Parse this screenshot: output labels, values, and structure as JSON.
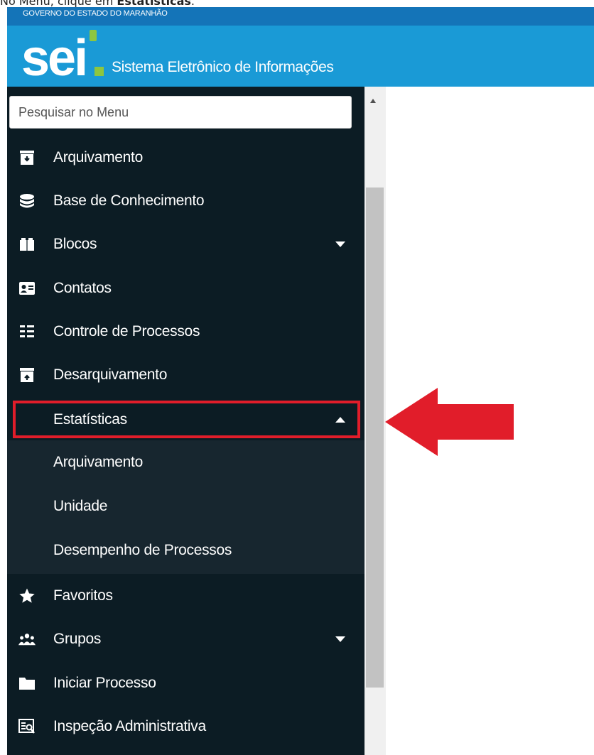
{
  "instruction": {
    "prefix": "No Menu, clique em",
    "emphasis": "Estatísticas",
    "suffix": "."
  },
  "gov_bar": {
    "text": "GOVERNO DO ESTADO DO MARANHÃO"
  },
  "header": {
    "logo_text": "sei",
    "title": "Sistema Eletrônico de Informações"
  },
  "search": {
    "placeholder": "Pesquisar no Menu"
  },
  "menu": {
    "arquivamento": "Arquivamento",
    "base_conhecimento": "Base de Conhecimento",
    "blocos": "Blocos",
    "contatos": "Contatos",
    "controle_processos": "Controle de Processos",
    "desarquivamento": "Desarquivamento",
    "estatisticas": "Estatísticas",
    "sub_arquivamento": "Arquivamento",
    "sub_unidade": "Unidade",
    "sub_desempenho": "Desempenho de Processos",
    "favoritos": "Favoritos",
    "grupos": "Grupos",
    "iniciar_processo": "Iniciar Processo",
    "inspecao": "Inspeção Administrativa"
  },
  "colors": {
    "gov_bar": "#1474b8",
    "header": "#1a9ad6",
    "sidebar": "#0c1c24",
    "submenu": "#17262f",
    "highlight": "#e11d2a",
    "logo_green": "#8dc63f"
  },
  "icons": {
    "arquivamento": "archive-down-icon",
    "base_conhecimento": "database-icon",
    "blocos": "blocks-icon",
    "contatos": "contact-card-icon",
    "controle_processos": "list-icon",
    "desarquivamento": "archive-up-icon",
    "favoritos": "star-icon",
    "grupos": "users-group-icon",
    "iniciar_processo": "folder-icon",
    "inspecao": "inspection-icon"
  }
}
